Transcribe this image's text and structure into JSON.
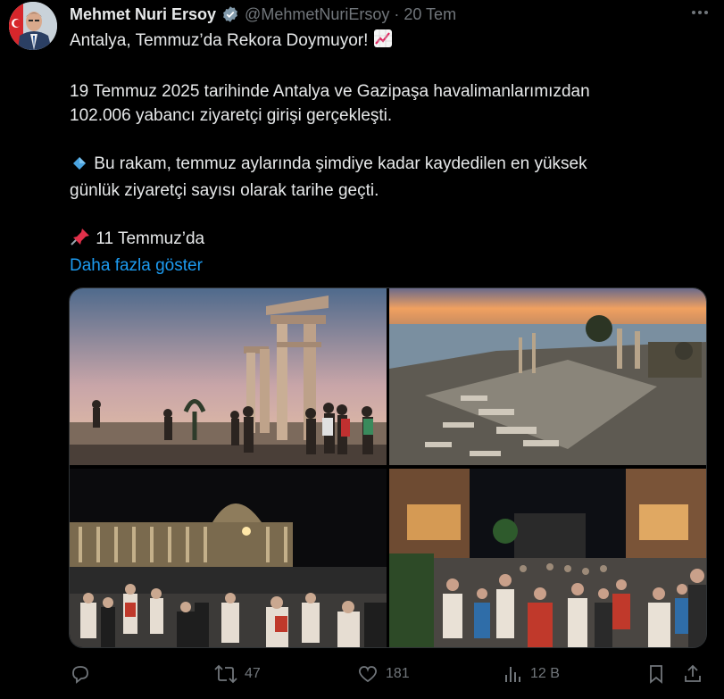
{
  "author": {
    "name": "Mehmet Nuri Ersoy",
    "handle": "@MehmetNuriErsoy",
    "separator": "·",
    "time": "20 Tem",
    "more": "•••"
  },
  "post": {
    "line1": "Antalya, Temmuz’da Rekora Doymuyor!",
    "para2_line1": "19 Temmuz 2025 tarihinde Antalya ve Gazipaşa havalimanlarımızdan",
    "para2_line2": "102.006 yabancı ziyaretçi girişi gerçekleşti.",
    "para3_line1": "Bu rakam, temmuz aylarında şimdiye kadar kaydedilen en yüksek",
    "para3_line2": "günlük ziyaretçi sayısı olarak tarihe geçti.",
    "para4": "11 Temmuz’da",
    "show_more": "Daha fazla göster"
  },
  "media": [
    {
      "name": "photo-temple-apollo-sunset"
    },
    {
      "name": "photo-side-aerial-sunset"
    },
    {
      "name": "photo-theatre-night"
    },
    {
      "name": "photo-street-crowd-night"
    }
  ],
  "actions": {
    "reply": "",
    "retweet": "47",
    "like": "181",
    "views": "12 B"
  },
  "colors": {
    "background": "#000000",
    "text": "#e7e9ea",
    "muted": "#71767b",
    "link": "#1d9bf0",
    "verified": "#829aab"
  }
}
